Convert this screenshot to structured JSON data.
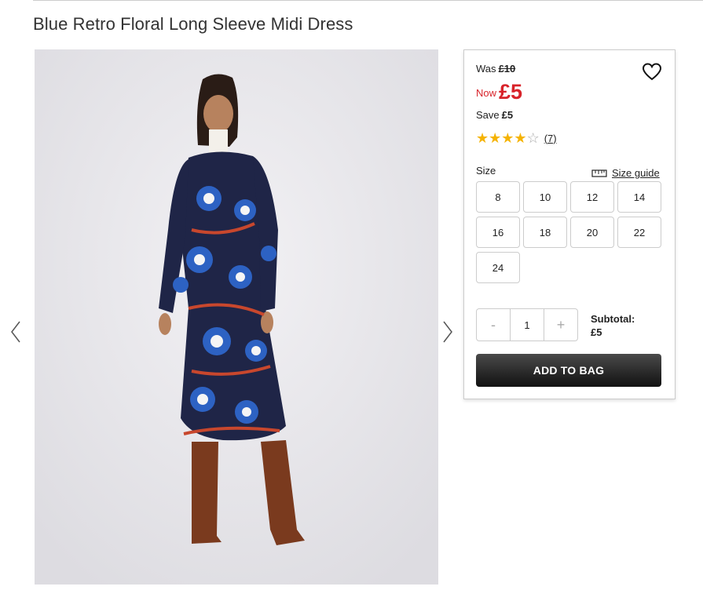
{
  "product": {
    "title": "Blue Retro Floral Long Sleeve Midi Dress",
    "price": {
      "was_label": "Was",
      "was_value": "£10",
      "now_label": "Now",
      "now_value": "£5",
      "save_label": "Save",
      "save_value": "£5"
    },
    "rating": {
      "stars": 4,
      "max": 5,
      "count": "(7)"
    },
    "size_label": "Size",
    "size_guide": "Size guide",
    "sizes": [
      "8",
      "10",
      "12",
      "14",
      "16",
      "18",
      "20",
      "22",
      "24"
    ],
    "quantity": {
      "minus": "-",
      "value": "1",
      "plus": "+"
    },
    "subtotal_label": "Subtotal:",
    "subtotal_value": "£5",
    "add_to_bag": "ADD TO BAG"
  },
  "icons": {
    "wishlist": "heart-icon",
    "prev": "chevron-left-icon",
    "next": "chevron-right-icon",
    "size_guide": "ruler-icon",
    "star": "star-icon"
  },
  "colors": {
    "sale_red": "#d8232a",
    "star_gold": "#f5b301",
    "button_dark": "#222222"
  }
}
